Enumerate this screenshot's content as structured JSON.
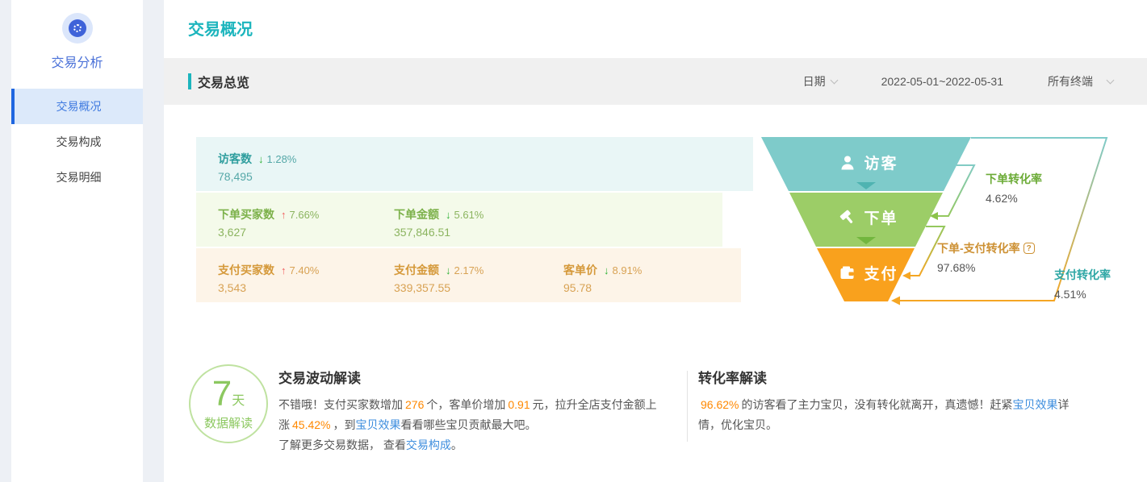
{
  "sidebar": {
    "group_title": "交易分析",
    "items": [
      {
        "label": "交易概况",
        "active": true
      },
      {
        "label": "交易构成",
        "active": false
      },
      {
        "label": "交易明细",
        "active": false
      }
    ]
  },
  "header": {
    "title": "交易概况"
  },
  "section": {
    "title": "交易总览",
    "filters": {
      "date_label": "日期",
      "date_range": "2022-05-01~2022-05-31",
      "terminal": "所有终端"
    }
  },
  "overview": {
    "rows": [
      {
        "theme": "visitor",
        "items": [
          {
            "label": "访客数",
            "trend": "down",
            "change": "1.28%",
            "value": "78,495"
          }
        ]
      },
      {
        "theme": "order",
        "items": [
          {
            "label": "下单买家数",
            "trend": "up",
            "change": "7.66%",
            "value": "3,627"
          },
          {
            "label": "下单金额",
            "trend": "down",
            "change": "5.61%",
            "value": "357,846.51"
          }
        ]
      },
      {
        "theme": "pay",
        "items": [
          {
            "label": "支付买家数",
            "trend": "up",
            "change": "7.40%",
            "value": "3,543"
          },
          {
            "label": "支付金额",
            "trend": "down",
            "change": "2.17%",
            "value": "339,357.55"
          },
          {
            "label": "客单价",
            "trend": "down",
            "change": "8.91%",
            "value": "95.78"
          }
        ]
      }
    ]
  },
  "funnel": {
    "stages": [
      {
        "label": "访客",
        "icon": "user-icon",
        "color": "#7ecbca"
      },
      {
        "label": "下单",
        "icon": "gavel-icon",
        "color": "#9ccd67"
      },
      {
        "label": "支付",
        "icon": "wallet-icon",
        "color": "#f9a11d"
      }
    ],
    "conversions": [
      {
        "label": "下单转化率",
        "value": "4.62%"
      },
      {
        "label": "下单-支付转化率",
        "value": "97.68%",
        "help_glyph": "?"
      },
      {
        "label": "支付转化率",
        "value": "4.51%"
      }
    ]
  },
  "insights": {
    "badge": {
      "big": "7",
      "unit": "天",
      "caption": "数据解读"
    },
    "left": {
      "title": "交易波动解读",
      "p1": [
        {
          "t": "不错哦！支付买家数增加",
          "c": "text"
        },
        {
          "t": "276",
          "c": "num"
        },
        {
          "t": "个，客单价增加",
          "c": "text"
        },
        {
          "t": "0.91",
          "c": "num"
        },
        {
          "t": "元，拉升全店支付金额上涨",
          "c": "text"
        },
        {
          "t": "45.42%",
          "c": "num"
        },
        {
          "t": "，到",
          "c": "text"
        },
        {
          "t": "宝贝效果",
          "c": "link"
        },
        {
          "t": "看看哪些宝贝贡献最大吧。",
          "c": "text"
        }
      ],
      "p2": [
        {
          "t": "了解更多交易数据， 查看",
          "c": "text"
        },
        {
          "t": "交易构成",
          "c": "link"
        },
        {
          "t": "。",
          "c": "text"
        }
      ]
    },
    "right": {
      "title": "转化率解读",
      "p1": [
        {
          "t": "96.62%",
          "c": "num"
        },
        {
          "t": "的访客看了主力宝贝，没有转化就离开，真遗憾！赶紧",
          "c": "text"
        },
        {
          "t": "宝贝效果",
          "c": "link"
        },
        {
          "t": "详情，优化宝贝。",
          "c": "text"
        }
      ]
    }
  },
  "colors": {
    "accent_teal": "#1cb5bd",
    "sidebar_active_blue": "#1f66e0",
    "funnel_visitor": "#7ecbca",
    "funnel_order": "#9ccd67",
    "funnel_pay": "#f9a11d",
    "trend_up_red": "#f15b5b",
    "trend_down_green": "#2eb135",
    "highlight_orange": "#ff8800",
    "link_blue": "#3e8ede"
  }
}
